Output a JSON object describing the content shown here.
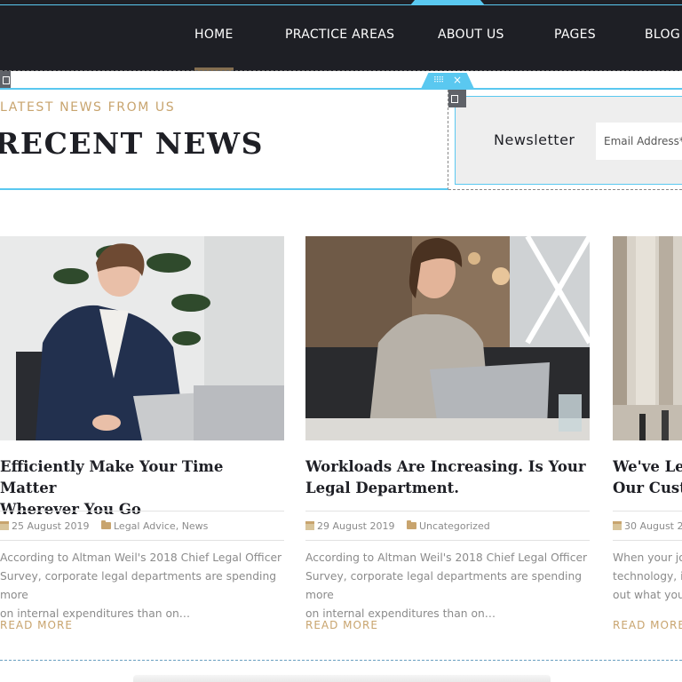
{
  "nav": {
    "items": [
      "HOME",
      "PRACTICE AREAS",
      "ABOUT US",
      "PAGES",
      "BLOG"
    ],
    "active": "HOME"
  },
  "section": {
    "subtitle": "LATEST NEWS FROM US",
    "title": "RECENT NEWS"
  },
  "newsletter": {
    "label": "Newsletter",
    "placeholder": "Email Address*"
  },
  "posts": [
    {
      "title": "Efficiently Make Your Time Matter\nWherever You Go",
      "date": "25 August 2019",
      "categories": [
        "Legal Advice",
        "News"
      ],
      "excerpt": "According to Altman Weil's 2018 Chief Legal Officer\nSurvey, corporate legal departments are spending more\non internal expenditures than on…",
      "read_more": "READ MORE"
    },
    {
      "title": "Workloads Are Increasing. Is Your\nLegal Department.",
      "date": "29 August 2019",
      "categories": [
        "Uncategorized"
      ],
      "excerpt": "According to Altman Weil's 2018 Chief Legal Officer\nSurvey, corporate legal departments are spending more\non internal expenditures than on…",
      "read_more": "READ MORE"
    },
    {
      "title": "We've Lea\nOur Custo",
      "date": "30 August 2",
      "categories": [],
      "excerpt": "When your job\ntechnology, it'\nout what you c",
      "read_more": "READ MORE"
    }
  ],
  "colors": {
    "nav_bg": "#1e1f25",
    "accent_gold": "#c8a46e",
    "builder_blue": "#5ac8f0",
    "text_muted": "#8b8b8b"
  }
}
